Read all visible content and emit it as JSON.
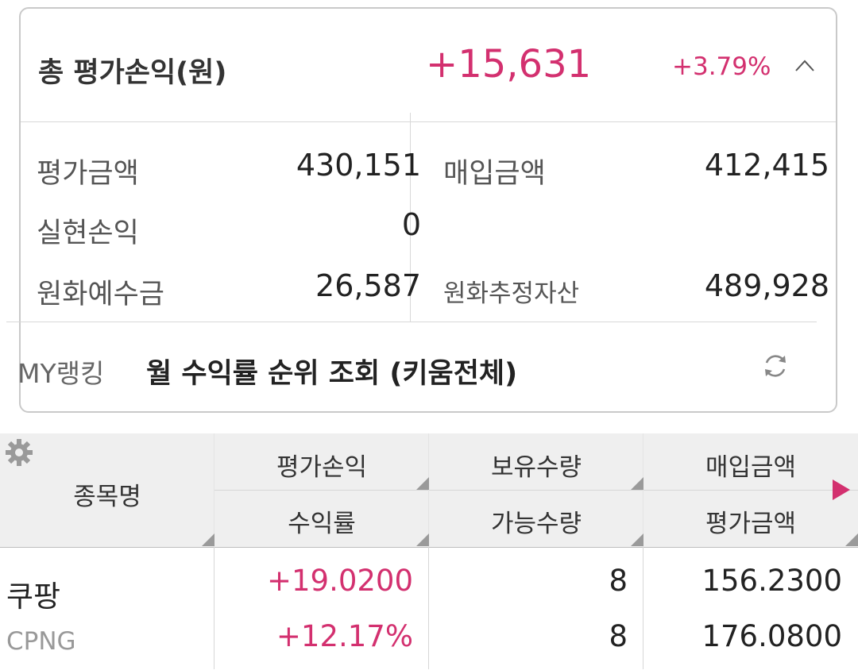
{
  "summary": {
    "title": "총 평가손익(원)",
    "total_pnl": "+15,631",
    "total_rate": "+3.79%",
    "items": {
      "eval_amount_label": "평가금액",
      "eval_amount": "430,151",
      "purchase_amount_label": "매입금액",
      "purchase_amount": "412,415",
      "realized_pnl_label": "실현손익",
      "realized_pnl": "0",
      "krw_deposit_label": "원화예수금",
      "krw_deposit": "26,587",
      "krw_est_assets_label": "원화추정자산",
      "krw_est_assets": "489,928"
    },
    "ranking_label": "MY랭킹",
    "ranking_link": "월 수익률 순위 조회 (키움전체)"
  },
  "table": {
    "headers": {
      "name": "종목명",
      "eval_pnl": "평가손익",
      "return_rate": "수익률",
      "holding_qty": "보유수량",
      "available_qty": "가능수량",
      "purchase_amount": "매입금액",
      "eval_amount": "평가금액"
    },
    "rows": [
      {
        "name": "쿠팡",
        "ticker": "CPNG",
        "eval_pnl": "+19.0200",
        "return_rate": "+12.17%",
        "holding_qty": "8",
        "available_qty": "8",
        "purchase_amount": "156.2300",
        "eval_amount": "176.0800"
      }
    ]
  },
  "colors": {
    "positive": "#d3306f",
    "header_bg": "#efefef"
  },
  "icons": [
    "chevron-up-icon",
    "refresh-icon",
    "gear-icon",
    "play-icon"
  ]
}
